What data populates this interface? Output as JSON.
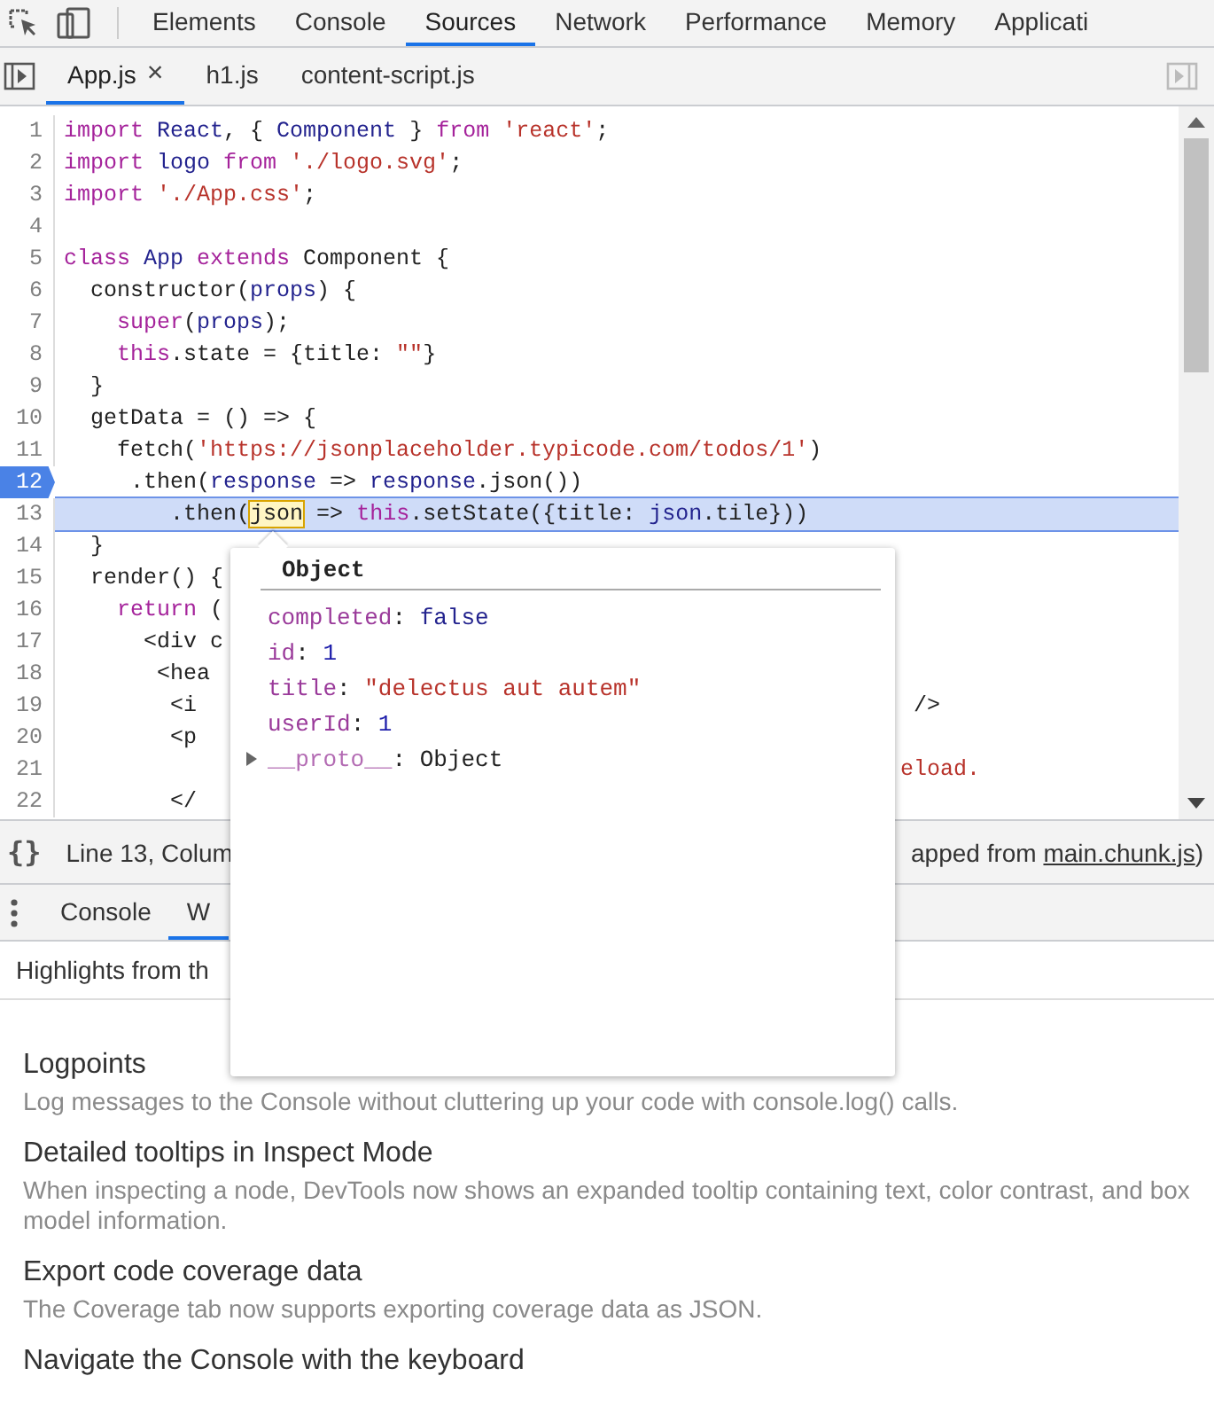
{
  "main_tabs": [
    {
      "label": "Elements",
      "selected": false
    },
    {
      "label": "Console",
      "selected": false
    },
    {
      "label": "Sources",
      "selected": true
    },
    {
      "label": "Network",
      "selected": false
    },
    {
      "label": "Performance",
      "selected": false
    },
    {
      "label": "Memory",
      "selected": false
    },
    {
      "label": "Applicati",
      "selected": false
    }
  ],
  "file_tabs": [
    {
      "label": "App.js",
      "selected": true,
      "close": "×"
    },
    {
      "label": "h1.js",
      "selected": false
    },
    {
      "label": "content-script.js",
      "selected": false
    }
  ],
  "editor": {
    "lines": [
      {
        "number": "1",
        "breakpoint": false,
        "current": false,
        "tokens": [
          {
            "kind": "kw",
            "text": "import"
          },
          {
            "kind": "var",
            "text": " React"
          },
          {
            "kind": "plain",
            "text": ", { "
          },
          {
            "kind": "var",
            "text": "Component"
          },
          {
            "kind": "plain",
            "text": " } "
          },
          {
            "kind": "kw",
            "text": "from"
          },
          {
            "kind": "str",
            "text": " 'react'"
          },
          {
            "kind": "plain",
            "text": ";"
          }
        ]
      },
      {
        "number": "2",
        "breakpoint": false,
        "current": false,
        "tokens": [
          {
            "kind": "kw",
            "text": "import"
          },
          {
            "kind": "var",
            "text": " logo"
          },
          {
            "kind": "kw",
            "text": " from"
          },
          {
            "kind": "str",
            "text": " './logo.svg'"
          },
          {
            "kind": "plain",
            "text": ";"
          }
        ]
      },
      {
        "number": "3",
        "breakpoint": false,
        "current": false,
        "tokens": [
          {
            "kind": "kw",
            "text": "import"
          },
          {
            "kind": "str",
            "text": " './App.css'"
          },
          {
            "kind": "plain",
            "text": ";"
          }
        ]
      },
      {
        "number": "4",
        "breakpoint": false,
        "current": false
      },
      {
        "number": "5",
        "breakpoint": false,
        "current": false,
        "tokens": [
          {
            "kind": "kw",
            "text": "class"
          },
          {
            "kind": "var",
            "text": " App"
          },
          {
            "kind": "kw",
            "text": " extends"
          },
          {
            "kind": "plain",
            "text": " Component {"
          }
        ]
      },
      {
        "number": "6",
        "breakpoint": false,
        "current": false,
        "tokens": [
          {
            "kind": "plain",
            "text": "  constructor("
          },
          {
            "kind": "var",
            "text": "props"
          },
          {
            "kind": "plain",
            "text": ") {"
          }
        ]
      },
      {
        "number": "7",
        "breakpoint": false,
        "current": false,
        "tokens": [
          {
            "kind": "kw",
            "text": "    super"
          },
          {
            "kind": "plain",
            "text": "("
          },
          {
            "kind": "var",
            "text": "props"
          },
          {
            "kind": "plain",
            "text": ");"
          }
        ]
      },
      {
        "number": "8",
        "breakpoint": false,
        "current": false,
        "tokens": [
          {
            "kind": "kw",
            "text": "    this"
          },
          {
            "kind": "plain",
            "text": ".state = {title: "
          },
          {
            "kind": "str",
            "text": "\"\""
          },
          {
            "kind": "plain",
            "text": "}"
          }
        ]
      },
      {
        "number": "9",
        "breakpoint": false,
        "current": false,
        "tokens": [
          {
            "kind": "plain",
            "text": "  }"
          }
        ]
      },
      {
        "number": "10",
        "breakpoint": false,
        "current": false,
        "tokens": [
          {
            "kind": "plain",
            "text": "  getData = () => {"
          }
        ]
      },
      {
        "number": "11",
        "breakpoint": false,
        "current": false,
        "tokens": [
          {
            "kind": "plain",
            "text": "    fetch("
          },
          {
            "kind": "str",
            "text": "'https://jsonplaceholder.typicode.com/todos/1'"
          },
          {
            "kind": "plain",
            "text": ")"
          }
        ]
      },
      {
        "number": "12",
        "breakpoint": true,
        "current": false,
        "tokens": [
          {
            "kind": "plain",
            "text": "     .then("
          },
          {
            "kind": "var",
            "text": "response"
          },
          {
            "kind": "plain",
            "text": " => "
          },
          {
            "kind": "var",
            "text": "response"
          },
          {
            "kind": "plain",
            "text": ".json())"
          }
        ]
      },
      {
        "number": "13",
        "breakpoint": false,
        "current": true,
        "tokens": [
          {
            "kind": "plain",
            "text": "        .then("
          },
          {
            "kind": "match",
            "text": "json"
          },
          {
            "kind": "plain",
            "text": " => "
          },
          {
            "kind": "kw",
            "text": "this"
          },
          {
            "kind": "plain",
            "text": ".setState({title: "
          },
          {
            "kind": "var",
            "text": "json"
          },
          {
            "kind": "plain",
            "text": ".tile}))"
          }
        ]
      },
      {
        "number": "14",
        "breakpoint": false,
        "current": false,
        "tokens": [
          {
            "kind": "plain",
            "text": "  }"
          }
        ]
      },
      {
        "number": "15",
        "breakpoint": false,
        "current": false,
        "tokens": [
          {
            "kind": "plain",
            "text": "  render() {"
          }
        ]
      },
      {
        "number": "16",
        "breakpoint": false,
        "current": false,
        "tokens": [
          {
            "kind": "kw",
            "text": "    return"
          },
          {
            "kind": "plain",
            "text": " ("
          }
        ]
      },
      {
        "number": "17",
        "breakpoint": false,
        "current": false,
        "tokens": [
          {
            "kind": "plain",
            "text": "      <div c"
          }
        ]
      },
      {
        "number": "18",
        "breakpoint": false,
        "current": false,
        "tokens": [
          {
            "kind": "plain",
            "text": "       <hea"
          }
        ]
      },
      {
        "number": "19",
        "breakpoint": false,
        "current": false,
        "tokens": [
          {
            "kind": "plain",
            "text": "        <i"
          }
        ],
        "tail": [
          {
            "kind": "plain",
            "text": " />"
          }
        ]
      },
      {
        "number": "20",
        "breakpoint": false,
        "current": false,
        "tokens": [
          {
            "kind": "plain",
            "text": "        <p"
          }
        ]
      },
      {
        "number": "21",
        "breakpoint": false,
        "current": false,
        "tail": [
          {
            "kind": "str",
            "text": "eload."
          }
        ]
      },
      {
        "number": "22",
        "breakpoint": false,
        "current": false,
        "tokens": [
          {
            "kind": "plain",
            "text": "        </"
          }
        ]
      }
    ]
  },
  "popover": {
    "title": "Object",
    "properties": [
      {
        "key": "completed",
        "sep": ": ",
        "value": "false",
        "kind": "bool"
      },
      {
        "key": "id",
        "sep": ": ",
        "value": "1",
        "kind": "num"
      },
      {
        "key": "title",
        "sep": ": ",
        "value": "\"delectus aut autem\"",
        "kind": "str"
      },
      {
        "key": "userId",
        "sep": ": ",
        "value": "1",
        "kind": "num"
      },
      {
        "key": "__proto__",
        "sep": ": ",
        "value": "Object",
        "kind": "object",
        "expanded": false
      }
    ]
  },
  "status_bar": {
    "format_button": "{}",
    "position": "Line 13, Colum",
    "source_prefix": "apped from ",
    "source_link": "main.chunk.js",
    "source_suffix": ")"
  },
  "drawer": {
    "tabs": [
      {
        "label": "Console",
        "selected": false
      },
      {
        "label": "W",
        "selected": true
      }
    ],
    "banner": "Highlights from th",
    "items": [
      {
        "title": "Logpoints",
        "description": "Log messages to the Console without cluttering up your code with console.log() calls."
      },
      {
        "title": "Detailed tooltips in Inspect Mode",
        "description": "When inspecting a node, DevTools now shows an expanded tooltip containing text, color contrast, and box model information."
      },
      {
        "title": "Export code coverage data",
        "description": "The Coverage tab now supports exporting coverage data as JSON."
      },
      {
        "title": "Navigate the Console with the keyboard"
      }
    ]
  }
}
